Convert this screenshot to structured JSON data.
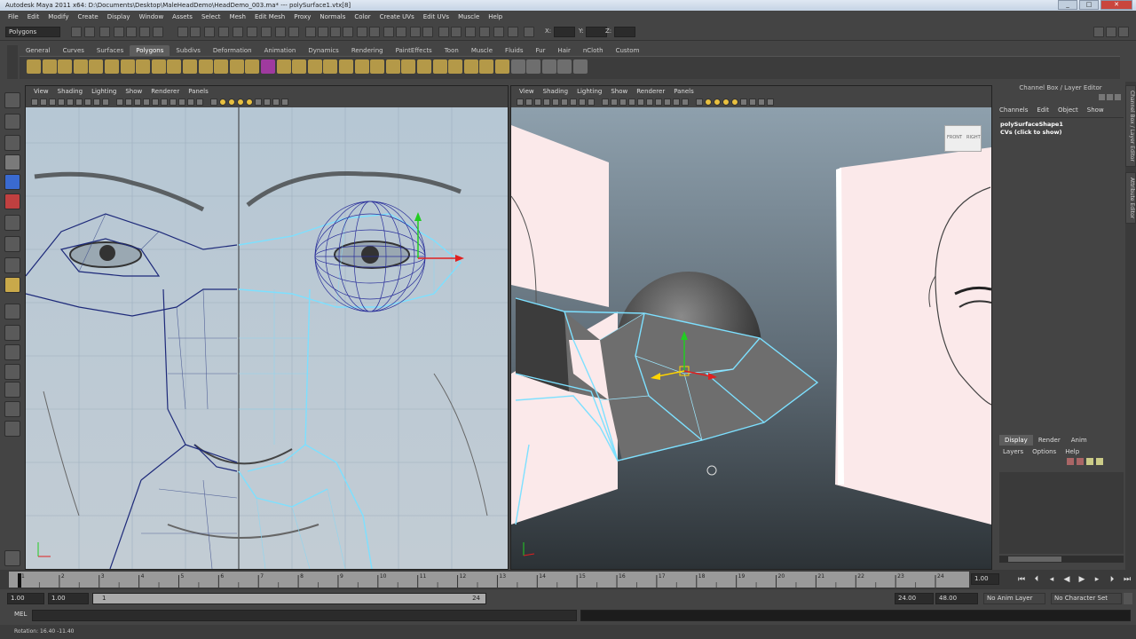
{
  "window": {
    "title": "Autodesk Maya 2011 x64: D:\\Documents\\Desktop\\MaleHeadDemo\\HeadDemo_003.ma*   ---   polySurface1.vtx[8]"
  },
  "menu": [
    "File",
    "Edit",
    "Modify",
    "Create",
    "Display",
    "Window",
    "Assets",
    "Select",
    "Mesh",
    "Edit Mesh",
    "Proxy",
    "Normals",
    "Color",
    "Create UVs",
    "Edit UVs",
    "Muscle",
    "Help"
  ],
  "status": {
    "mode": "Polygons",
    "x_label": "X:",
    "y_label": "Y:",
    "z_label": "Z:"
  },
  "shelf_tabs": [
    "General",
    "Curves",
    "Surfaces",
    "Polygons",
    "Subdivs",
    "Deformation",
    "Animation",
    "Dynamics",
    "Rendering",
    "PaintEffects",
    "Toon",
    "Muscle",
    "Fluids",
    "Fur",
    "Hair",
    "nCloth",
    "Custom"
  ],
  "shelf_active": "Polygons",
  "viewport_menu": [
    "View",
    "Shading",
    "Lighting",
    "Show",
    "Renderer",
    "Panels"
  ],
  "viewcube": {
    "front": "FRONT",
    "right": "RIGHT"
  },
  "channel_box": {
    "title": "Channel Box / Layer Editor",
    "menu": [
      "Channels",
      "Edit",
      "Object",
      "Show"
    ],
    "object": "polySurfaceShape1",
    "cvs": "CVs (click to show)"
  },
  "layer_editor": {
    "tabs": [
      "Display",
      "Render",
      "Anim"
    ],
    "active_tab": "Display",
    "menu": [
      "Layers",
      "Options",
      "Help"
    ]
  },
  "side_tabs": {
    "channel": "Channel Box / Layer Editor",
    "attr": "Attribute Editor"
  },
  "timeline": {
    "ticks": [
      "1",
      "2",
      "3",
      "4",
      "5",
      "6",
      "7",
      "8",
      "9",
      "10",
      "11",
      "12",
      "13",
      "14",
      "15",
      "16",
      "17",
      "18",
      "19",
      "20",
      "21",
      "22",
      "23",
      "24"
    ],
    "current_frame": "1.00",
    "playback_icons": [
      "go-start-icon",
      "step-back-key-icon",
      "step-back-icon",
      "play-back-icon",
      "play-forward-icon",
      "step-forward-icon",
      "step-forward-key-icon",
      "go-end-icon"
    ]
  },
  "range": {
    "start": "1.00",
    "start2": "1.00",
    "slider_start": "1",
    "slider_end": "24",
    "end": "24.00",
    "end2": "48.00",
    "anim_layer": "No Anim Layer",
    "char_set": "No Character Set"
  },
  "command_line": {
    "label": "MEL"
  },
  "help_line": {
    "text": "Rotation:  16.40   -11.40"
  }
}
